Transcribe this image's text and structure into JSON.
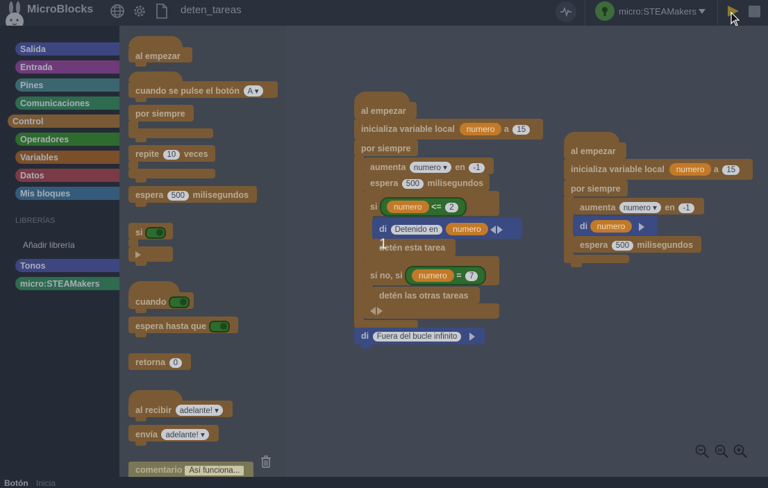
{
  "app": {
    "title": "MicroBlocks",
    "project_name": "deten_tareas"
  },
  "device": {
    "name": "micro:STEAMakers"
  },
  "icons": {
    "globe": "globe-icon",
    "gear": "gear-icon",
    "file": "file-icon",
    "pulse": "pulse-icon",
    "run": "play-icon",
    "stop": "stop-icon",
    "trash": "trash-icon",
    "zoom_out": "zoom-out-icon",
    "zoom_reset": "zoom-reset-icon",
    "zoom_in": "zoom-in-icon"
  },
  "colors": {
    "control": "#7a5a34",
    "output": "#3a4a82",
    "operators": "#2f6a2e",
    "variables": "#c27a2a"
  },
  "palette": {
    "categories": [
      {
        "label": "Salida",
        "color": "#3d4680"
      },
      {
        "label": "Entrada",
        "color": "#6e3a7a"
      },
      {
        "label": "Pines",
        "color": "#3b6670"
      },
      {
        "label": "Comunicaciones",
        "color": "#2e6b4f"
      },
      {
        "label": "Control",
        "color": "#7a5a34"
      },
      {
        "label": "Operadores",
        "color": "#2f6a2e"
      },
      {
        "label": "Variables",
        "color": "#7a4f2a"
      },
      {
        "label": "Datos",
        "color": "#7a3b47"
      },
      {
        "label": "Mis bloques",
        "color": "#345c7a"
      }
    ],
    "libraries_heading": "LIBRERÍAS",
    "add_library": "Añadir librería",
    "libraries": [
      {
        "label": "Tonos",
        "color": "#3d4680"
      },
      {
        "label": "micro:STEAMakers",
        "color": "#2e6b4f"
      }
    ]
  },
  "shelf": {
    "when_started": "al empezar",
    "when_button": "cuando se pulse el botón",
    "button_value": "A",
    "forever": "por siempre",
    "repeat": "repite",
    "repeat_value": "10",
    "repeat_suffix": "veces",
    "wait": "espera",
    "wait_value": "500",
    "wait_suffix": "milisegundos",
    "if": "si",
    "when": "cuando",
    "wait_until": "espera hasta que",
    "return": "retorna",
    "return_value": "0",
    "when_receive": "al recibir",
    "receive_value": "adelante!",
    "send": "envía",
    "send_value": "adelante!",
    "comment": "comentario",
    "comment_value": "Así funciona..."
  },
  "script1": {
    "hat": "al empezar",
    "init": "inicializa variable local",
    "var": "numero",
    "to": "a",
    "init_value": "15",
    "forever": "por siempre",
    "inc": "aumenta",
    "inc_var": "numero",
    "inc_by": "en",
    "inc_value": "-1",
    "wait": "espera",
    "wait_value": "500",
    "wait_suffix": "milisegundos",
    "if": "si",
    "cond_var": "numero",
    "cond_op": "<=",
    "cond_value": "2",
    "say": "di",
    "say_text": "Detenido en",
    "say_var": "numero",
    "stop_this": "detén esta tarea",
    "else_if": "si no, si",
    "cond2_var": "numero",
    "cond2_op": "=",
    "cond2_value": "7",
    "stop_others": "detén las otras tareas",
    "say2": "di",
    "say2_text": "Fuera del bucle infinito"
  },
  "script2": {
    "hat": "al empezar",
    "init": "inicializa variable local",
    "var": "numero",
    "to": "a",
    "init_value": "15",
    "forever": "por siempre",
    "inc": "aumenta",
    "inc_var": "numero",
    "inc_by": "en",
    "inc_value": "-1",
    "say": "di",
    "say_var": "numero",
    "wait": "espera",
    "wait_value": "500",
    "wait_suffix": "milisegundos"
  },
  "output_display": "1",
  "status": {
    "button": "Botón",
    "init": "Inicia"
  }
}
